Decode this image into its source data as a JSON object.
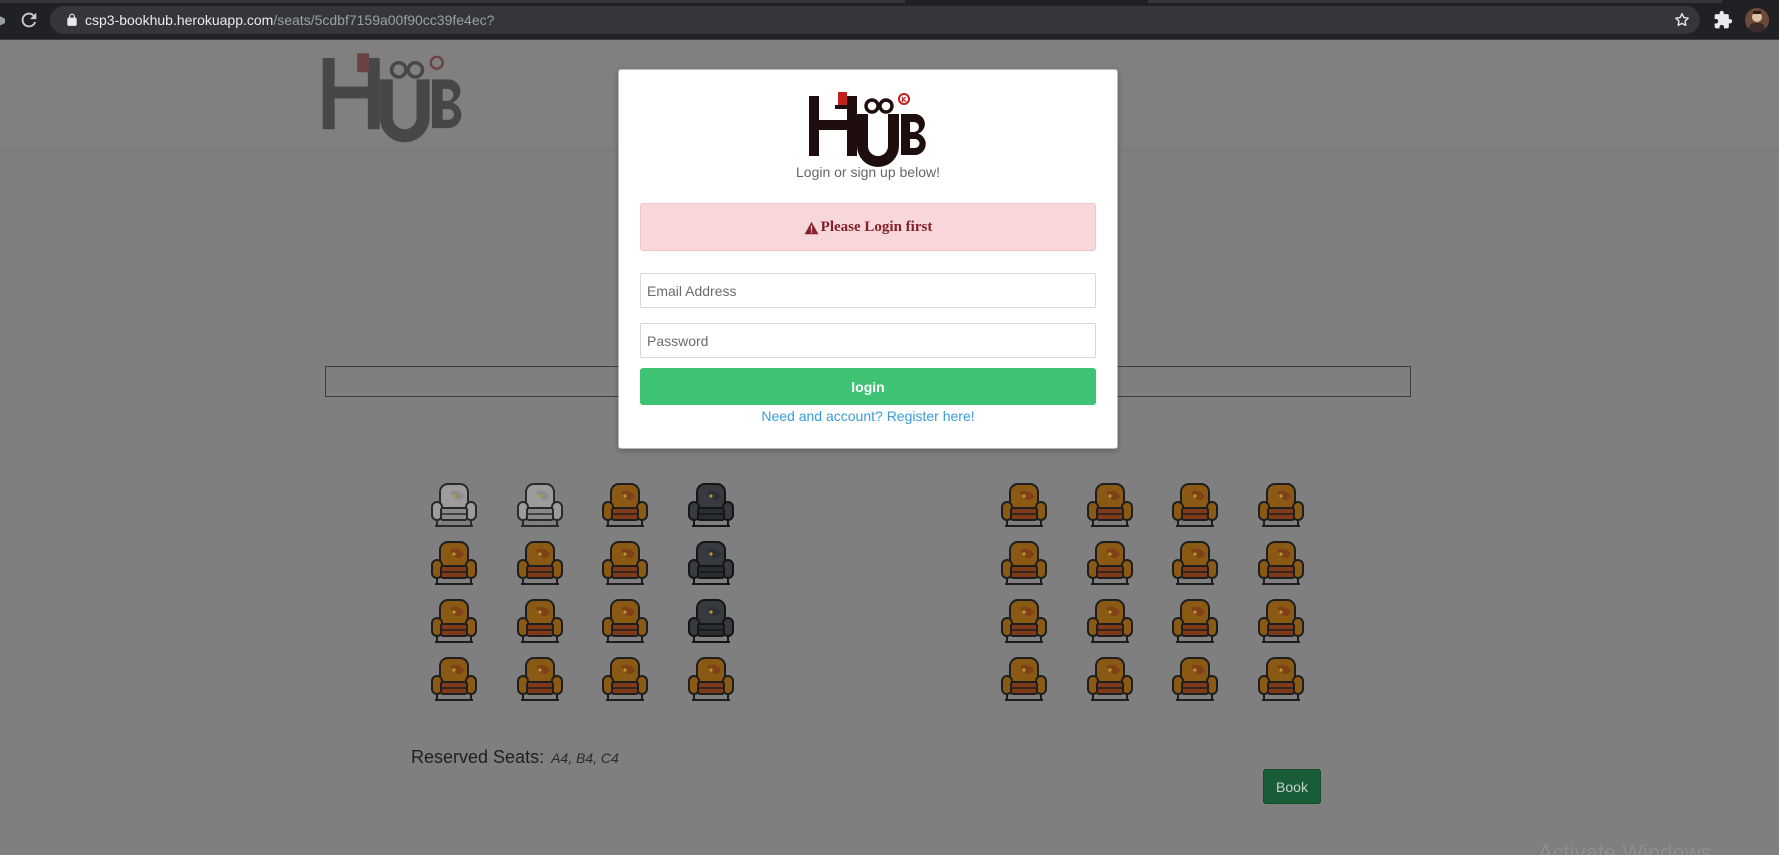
{
  "browser": {
    "url_host": "csp3-bookhub.herokuapp.com",
    "url_path": "/seats/5cdbf7159a00f90cc39fe4ec?"
  },
  "modal": {
    "subtitle": "Login or sign up below!",
    "alert": "Please Login first",
    "email_placeholder": "Email Address",
    "password_placeholder": "Password",
    "login_label": "login",
    "register_link": "Need and account? Register here!"
  },
  "seats": {
    "left": [
      [
        "available-grey",
        "available-grey",
        "open",
        "reserved"
      ],
      [
        "open",
        "open",
        "open",
        "reserved"
      ],
      [
        "open",
        "open",
        "open",
        "reserved"
      ],
      [
        "open",
        "open",
        "open",
        "open"
      ]
    ],
    "right": [
      [
        "open",
        "open",
        "open",
        "open"
      ],
      [
        "open",
        "open",
        "open",
        "open"
      ],
      [
        "open",
        "open",
        "open",
        "open"
      ],
      [
        "open",
        "open",
        "open",
        "open"
      ]
    ]
  },
  "reserved": {
    "label": "Reserved Seats:",
    "values": "A4, B4, C4"
  },
  "book_label": "Book",
  "watermark": "Activate Windows",
  "colors": {
    "login_green": "#3ec273",
    "alert_bg": "#f8d7da",
    "alert_text": "#842029",
    "link_blue": "#3a9dd8",
    "book_green": "#185d37"
  }
}
